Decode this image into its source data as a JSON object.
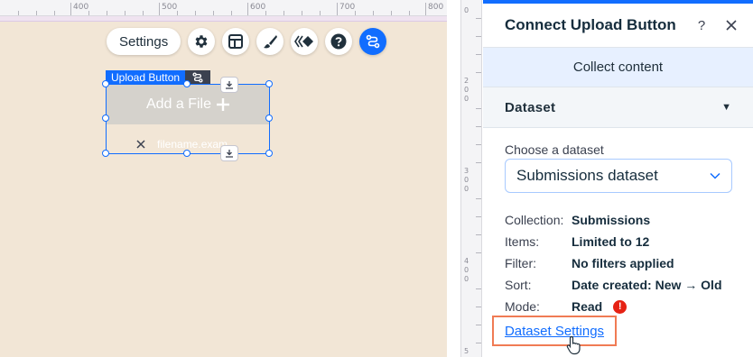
{
  "canvas": {
    "ruler_numbers": [
      "400",
      "500",
      "600",
      "700",
      "800"
    ],
    "toolbar": {
      "settings_label": "Settings",
      "icons": [
        "gear-icon",
        "layout-icon",
        "design-brush-icon",
        "animation-icon",
        "help-icon",
        "connect-data-icon"
      ]
    },
    "element": {
      "tag_label": "Upload Button",
      "button_label": "Add a File",
      "button_icon": "plus-icon",
      "file_name": "filename.exam"
    }
  },
  "vertical_ruler": {
    "numbers": [
      [
        "0"
      ],
      [
        "2",
        "0",
        "0"
      ],
      [
        "3",
        "0",
        "0"
      ],
      [
        "4",
        "0",
        "0"
      ],
      [
        "5"
      ]
    ]
  },
  "panel": {
    "title": "Connect Upload Button",
    "help_icon": "question-icon",
    "close_icon": "close-icon",
    "collect_label": "Collect content",
    "section_title": "Dataset",
    "choose_label": "Choose a dataset",
    "selected_dataset": "Submissions dataset",
    "info": {
      "collection_key": "Collection:",
      "collection_value": "Submissions",
      "items_key": "Items:",
      "items_value": "Limited to 12",
      "filter_key": "Filter:",
      "filter_value": "No filters applied",
      "sort_key": "Sort:",
      "sort_value": "Date created: New → Old",
      "mode_key": "Mode:",
      "mode_value": "Read",
      "mode_warning": "!"
    },
    "dataset_settings_link": "Dataset Settings"
  },
  "colors": {
    "accent": "#116dff",
    "canvas_bg": "#f2e6d6",
    "highlight": "#f07b54",
    "warning": "#e62214"
  }
}
